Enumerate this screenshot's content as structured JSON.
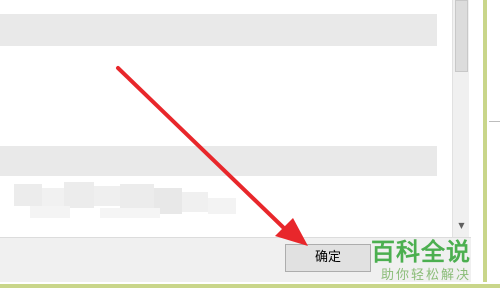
{
  "dialog": {
    "ok_button_label": "确定"
  },
  "watermark": {
    "title": "百科全说",
    "subtitle": "助你轻松解决"
  },
  "scrollbar": {
    "down_arrow": "▼"
  },
  "colors": {
    "band_gray": "#e9e9e9",
    "frame_green": "#c9d68a",
    "arrow_red": "#e8272b",
    "watermark_green": "#4caf50"
  }
}
